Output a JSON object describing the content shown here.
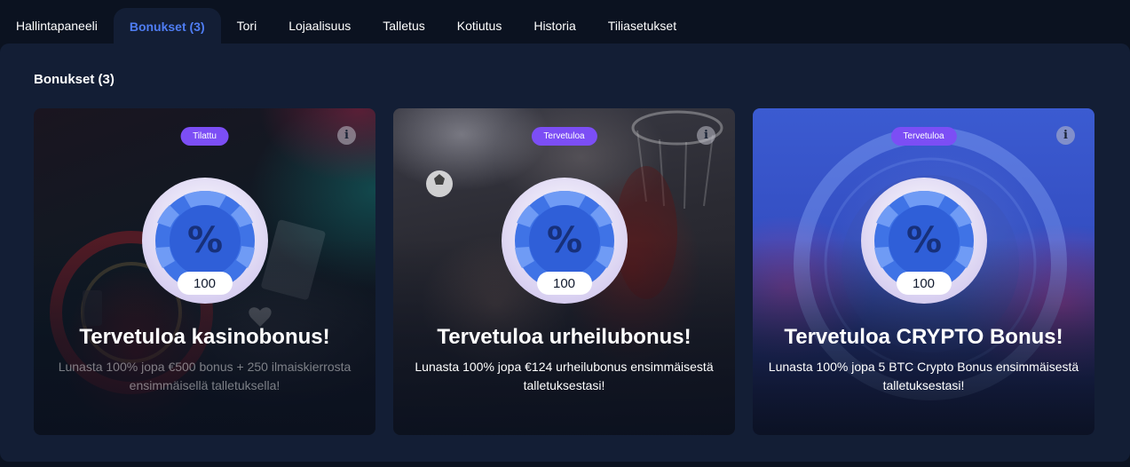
{
  "tabs": [
    {
      "label": "Hallintapaneeli",
      "active": false
    },
    {
      "label": "Bonukset (3)",
      "active": true
    },
    {
      "label": "Tori",
      "active": false
    },
    {
      "label": "Lojaalisuus",
      "active": false
    },
    {
      "label": "Talletus",
      "active": false
    },
    {
      "label": "Kotiutus",
      "active": false
    },
    {
      "label": "Historia",
      "active": false
    },
    {
      "label": "Tiliasetukset",
      "active": false
    }
  ],
  "section": {
    "title": "Bonukset (3)"
  },
  "cards": [
    {
      "badge": "Tilattu",
      "info_icon": "info-icon",
      "amount": "100",
      "title": "Tervetuloa kasinobonus!",
      "description": "Lunasta 100% jopa €500 bonus + 250 ilmaiskierrosta ensimmäisellä talletuksella!"
    },
    {
      "badge": "Tervetuloa",
      "info_icon": "info-icon",
      "amount": "100",
      "title": "Tervetuloa urheilubonus!",
      "description": "Lunasta 100% jopa €124 urheilubonus ensimmäisestä talletuksestasi!"
    },
    {
      "badge": "Tervetuloa",
      "info_icon": "info-icon",
      "amount": "100",
      "title": "Tervetuloa CRYPTO Bonus!",
      "description": "Lunasta 100% jopa 5 BTC Crypto Bonus ensimmäisestä talletuksestasi!"
    }
  ],
  "colors": {
    "accent": "#4f7df3",
    "badge": "#7c4ef5",
    "panel": "#131e35",
    "background": "#0b1220"
  }
}
